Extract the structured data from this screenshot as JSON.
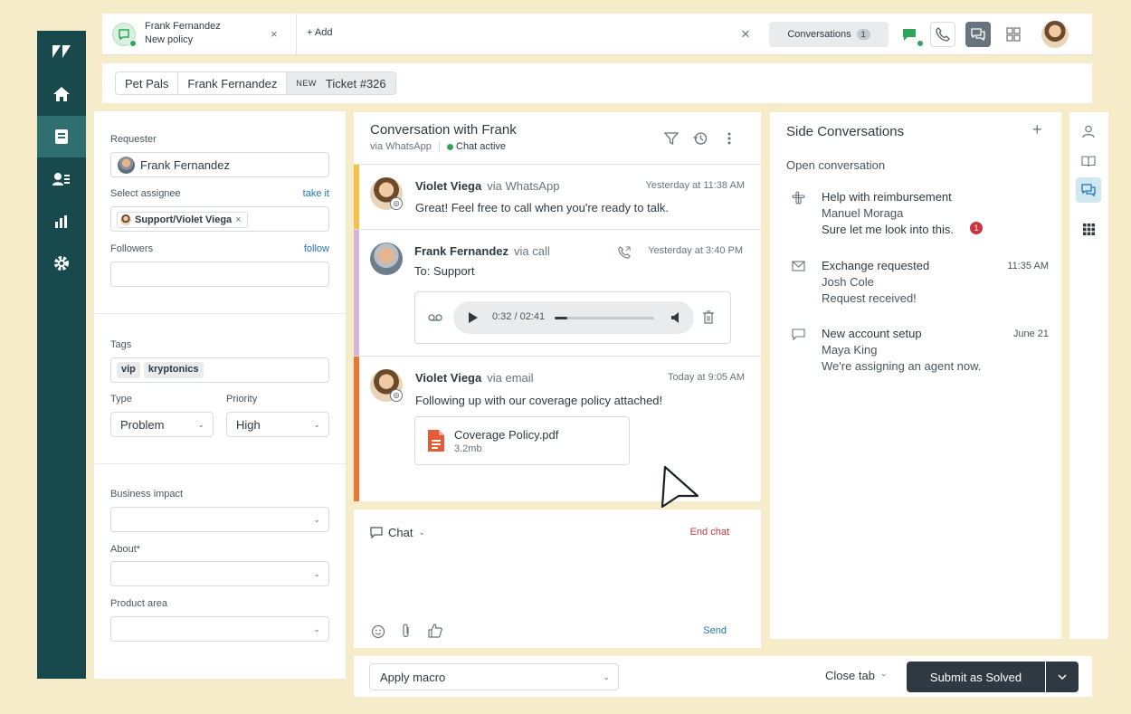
{
  "colors": {
    "background": "#f6ecc9",
    "nav": "#17494d",
    "nav_active": "#2f6f72",
    "whatsapp_bar": "#f5c04a",
    "call_bar": "#d2b5d8",
    "email_bar": "#ee7632",
    "primary_button": "#2f3941",
    "danger_text": "#cc3340",
    "link": "#1f73b7",
    "online": "#2fa55a"
  },
  "nav": {
    "items": [
      {
        "icon": "zendesk-logo-icon"
      },
      {
        "icon": "home-icon"
      },
      {
        "icon": "views-icon",
        "active": true
      },
      {
        "icon": "customers-icon"
      },
      {
        "icon": "reporting-icon"
      },
      {
        "icon": "settings-icon"
      }
    ]
  },
  "topbar": {
    "tab": {
      "name": "Frank Fernandez",
      "subtitle": "New policy",
      "close": "×"
    },
    "add_label": "Add",
    "close_all": "×",
    "conversations_label": "Conversations",
    "conversations_count": "1"
  },
  "breadcrumb": {
    "org": "Pet Pals",
    "requester": "Frank Fernandez",
    "status_badge": "NEW",
    "ticket": "Ticket #326"
  },
  "properties": {
    "requester_label": "Requester",
    "requester_value": "Frank Fernandez",
    "assignee_label": "Select assignee",
    "assignee_link": "take it",
    "assignee_value": "Support/Violet Viega",
    "followers_label": "Followers",
    "followers_link": "follow",
    "tags_label": "Tags",
    "tags": [
      "vip",
      "kryptonics"
    ],
    "type_label": "Type",
    "type_value": "Problem",
    "priority_label": "Priority",
    "priority_value": "High",
    "business_impact_label": "Business impact",
    "about_label": "About*",
    "product_area_label": "Product area"
  },
  "conversation": {
    "title": "Conversation with Frank",
    "channel": "via WhatsApp",
    "status": "Chat active",
    "messages": [
      {
        "author": "Violet Viega",
        "via": "via WhatsApp",
        "time": "Yesterday at 11:38 AM",
        "text": "Great! Feel free to call when you're ready to talk."
      },
      {
        "author": "Frank Fernandez",
        "via": "via call",
        "time": "Yesterday at 3:40 PM",
        "text": "To: Support",
        "audio_time": "0:32 / 02:41",
        "audio_progress": 0.13
      },
      {
        "author": "Violet Viega",
        "via": "via email",
        "time": "Today at 9:05 AM",
        "text": "Following up with our coverage policy attached!",
        "attachment_name": "Coverage Policy.pdf",
        "attachment_size": "3.2mb"
      }
    ]
  },
  "composer": {
    "mode": "Chat",
    "end_chat": "End chat",
    "send": "Send"
  },
  "footer": {
    "macro_placeholder": "Apply macro",
    "close_tab": "Close tab",
    "submit": "Submit as Solved"
  },
  "side_conversations": {
    "title": "Side Conversations",
    "open_label": "Open conversation",
    "items": [
      {
        "icon": "slack-icon",
        "title": "Help with reimbursement",
        "person": "Manuel Moraga",
        "preview": "Sure let me look into this.",
        "unread": "1",
        "time": ""
      },
      {
        "icon": "email-icon",
        "title": "Exchange requested",
        "person": "Josh Cole",
        "preview": "Request received!",
        "time": "11:35 AM"
      },
      {
        "icon": "chat-bubble-icon",
        "title": "New account setup",
        "person": "Maya King",
        "preview": "We're assigning an agent now.",
        "time": "June 21"
      }
    ]
  }
}
